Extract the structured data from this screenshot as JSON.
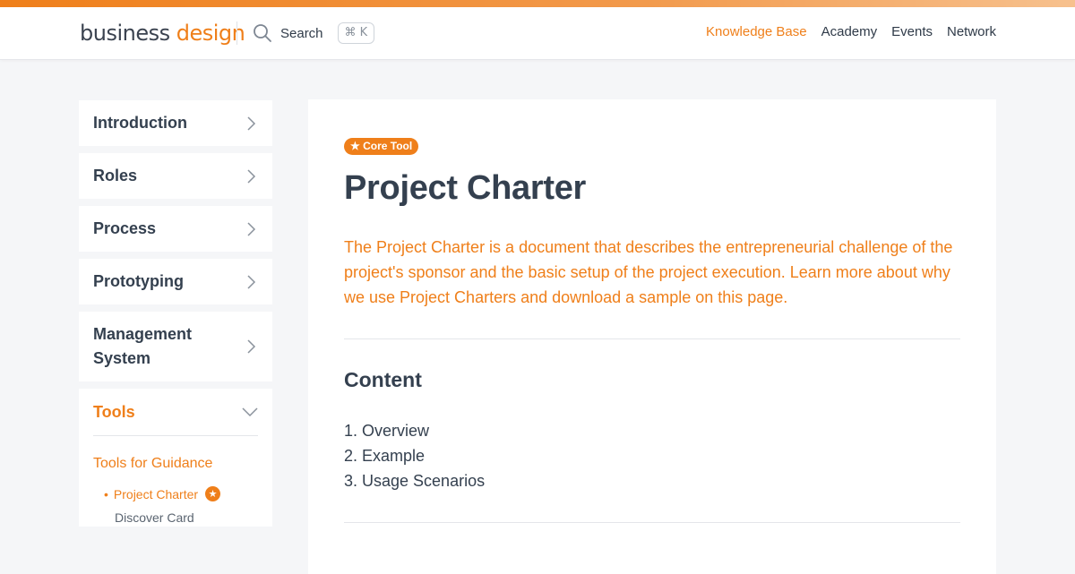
{
  "header": {
    "logo_word1": "business",
    "logo_word2": "design",
    "search_label": "Search",
    "shortcut": "⌘ K",
    "nav": [
      {
        "label": "Knowledge Base",
        "active": true
      },
      {
        "label": "Academy"
      },
      {
        "label": "Events"
      },
      {
        "label": "Network"
      }
    ]
  },
  "sidebar": {
    "items": [
      {
        "label": "Introduction",
        "icon": "chevron-right-icon"
      },
      {
        "label": "Roles",
        "icon": "chevron-right-icon"
      },
      {
        "label": "Process",
        "icon": "chevron-right-icon"
      },
      {
        "label": "Prototyping",
        "icon": "chevron-right-icon"
      },
      {
        "label": "Management System",
        "icon": "chevron-right-icon"
      }
    ],
    "tools": {
      "label": "Tools",
      "icon": "chevron-down-icon",
      "group": "Tools for Guidance",
      "sub_items": [
        {
          "label": "Project Charter",
          "active": true,
          "star": "★"
        },
        {
          "label": "Discover Card"
        }
      ]
    }
  },
  "main": {
    "badge": "★ Core Tool",
    "title": "Project Charter",
    "lead": "The Project Charter is a document that describes the entrepreneurial challenge of the project's sponsor and the basic setup of the project execution. Learn more about why we use Project Charters and download a sample on this page.",
    "content_heading": "Content",
    "toc": [
      "1. Overview",
      "2. Example",
      "3. Usage Scenarios"
    ]
  },
  "colors": {
    "accent": "#ef7f1a",
    "text": "#34404f",
    "background": "#f5f6f8"
  }
}
